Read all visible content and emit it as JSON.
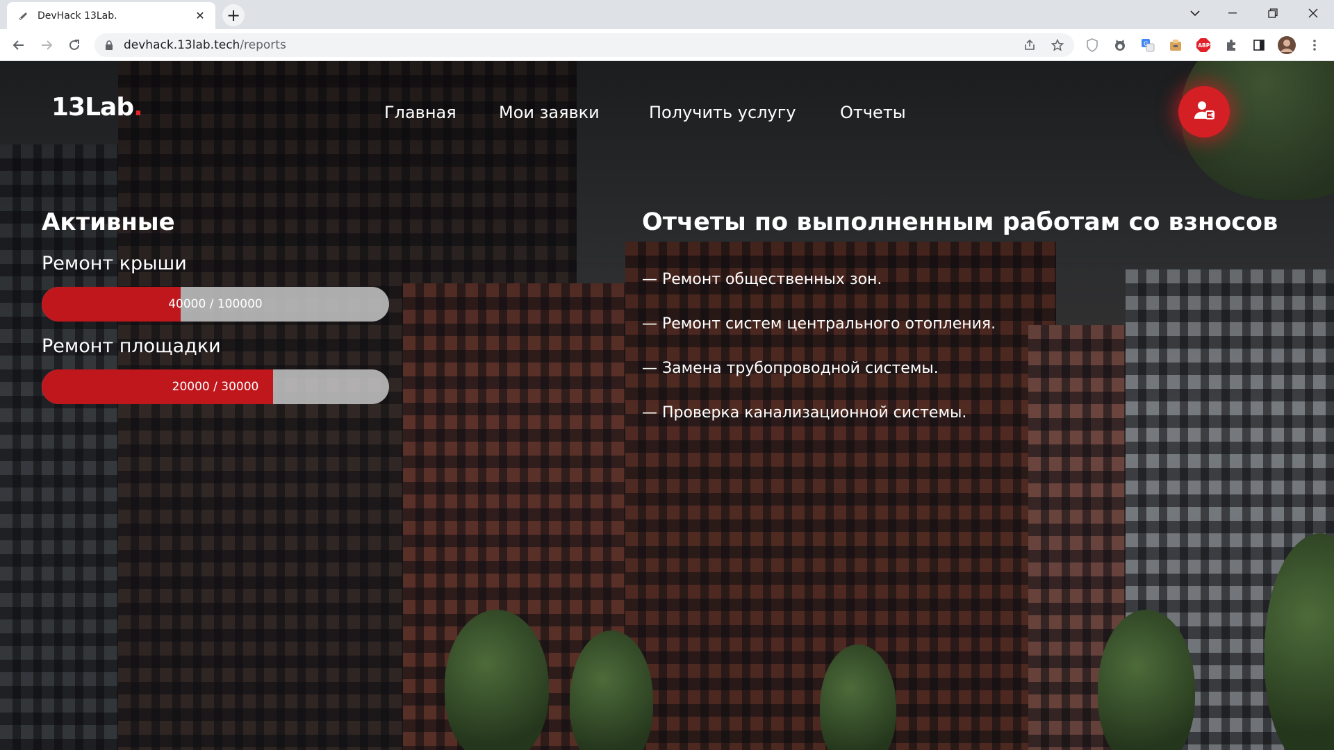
{
  "browser": {
    "tab_title": "DevHack 13Lab.",
    "url_host": "devhack.13lab.tech",
    "url_path": "/reports"
  },
  "site": {
    "logo_text": "13Lab",
    "logo_dot": ".",
    "nav": [
      {
        "label": "Главная"
      },
      {
        "label": "Мои заявки"
      },
      {
        "label": "Получить услугу"
      },
      {
        "label": "Отчеты"
      }
    ]
  },
  "active": {
    "title": "Активные",
    "funds": [
      {
        "name": "Ремонт крыши",
        "collected": 40000,
        "goal": 100000,
        "label": "40000 / 100000",
        "fraction": 0.4
      },
      {
        "name": "Ремонт площадки",
        "collected": 20000,
        "goal": 30000,
        "label": "20000 / 30000",
        "fraction": 0.6667
      }
    ]
  },
  "reports": {
    "title": "Отчеты по выполненным работам со взносов",
    "items": [
      "— Ремонт общественных зон.",
      "— Ремонт систем центрального отопления.",
      "— Замена трубопроводной системы.",
      "— Проверка канализационной системы."
    ]
  },
  "colors": {
    "accent": "#c0171d",
    "user_button": "#d41f25"
  }
}
